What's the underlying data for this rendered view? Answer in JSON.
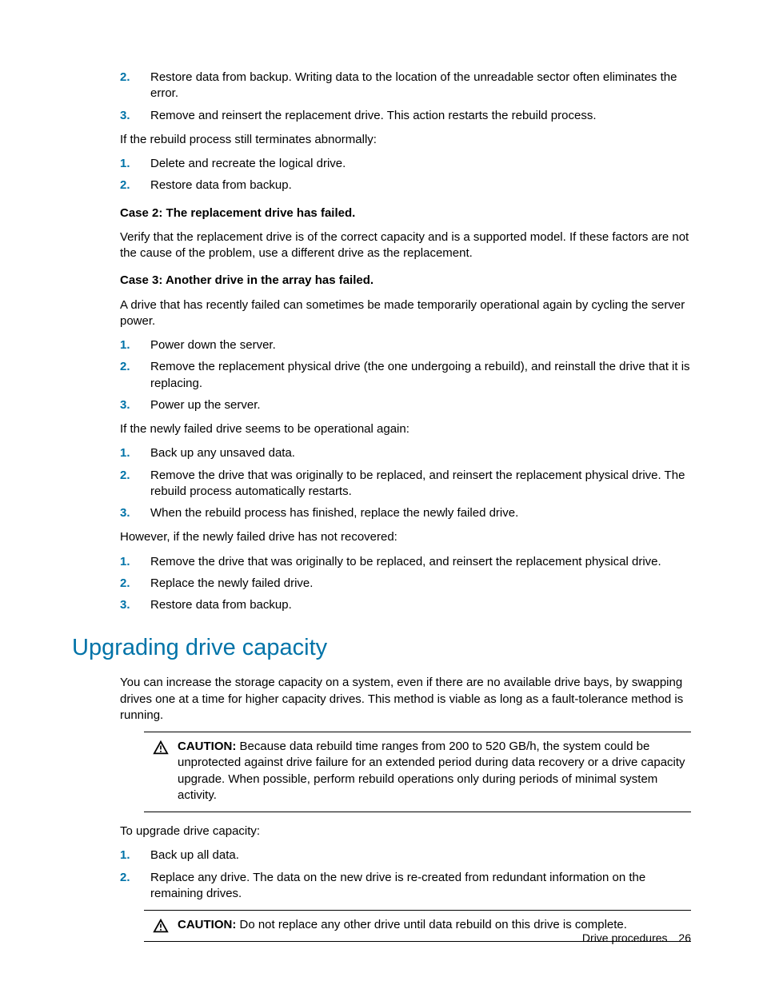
{
  "list_a": [
    {
      "n": "2.",
      "t": "Restore data from backup. Writing data to the location of the unreadable sector often eliminates the error."
    },
    {
      "n": "3.",
      "t": "Remove and reinsert the replacement drive. This action restarts the rebuild process."
    }
  ],
  "para_a": "If the rebuild process still terminates abnormally:",
  "list_b": [
    {
      "n": "1.",
      "t": "Delete and recreate the logical drive."
    },
    {
      "n": "2.",
      "t": "Restore data from backup."
    }
  ],
  "case2_title": "Case 2: The replacement drive has failed.",
  "case2_body": "Verify that the replacement drive is of the correct capacity and is a supported model. If these factors are not the cause of the problem, use a different drive as the replacement.",
  "case3_title": "Case 3: Another drive in the array has failed.",
  "case3_body": "A drive that has recently failed can sometimes be made temporarily operational again by cycling the server power.",
  "list_c": [
    {
      "n": "1.",
      "t": "Power down the server."
    },
    {
      "n": "2.",
      "t": "Remove the replacement physical drive (the one undergoing a rebuild), and reinstall the drive that it is replacing."
    },
    {
      "n": "3.",
      "t": "Power up the server."
    }
  ],
  "para_c": "If the newly failed drive seems to be operational again:",
  "list_d": [
    {
      "n": "1.",
      "t": "Back up any unsaved data."
    },
    {
      "n": "2.",
      "t": "Remove the drive that was originally to be replaced, and reinsert the replacement physical drive. The rebuild process automatically restarts."
    },
    {
      "n": "3.",
      "t": "When the rebuild process has finished, replace the newly failed drive."
    }
  ],
  "para_d": "However, if the newly failed drive has not recovered:",
  "list_e": [
    {
      "n": "1.",
      "t": "Remove the drive that was originally to be replaced, and reinsert the replacement physical drive."
    },
    {
      "n": "2.",
      "t": "Replace the newly failed drive."
    },
    {
      "n": "3.",
      "t": "Restore data from backup."
    }
  ],
  "heading": "Upgrading drive capacity",
  "upgrade_intro": "You can increase the storage capacity on a system, even if there are no available drive bays, by swapping drives one at a time for higher capacity drives. This method is viable as long as a fault-tolerance method is running.",
  "caution1_label": "CAUTION:",
  "caution1_text": "Because data rebuild time ranges from 200 to 520 GB/h, the system could be unprotected against drive failure for an extended period during data recovery or a drive capacity upgrade. When possible, perform rebuild operations only during periods of minimal system activity.",
  "upgrade_lead": "To upgrade drive capacity:",
  "list_f": [
    {
      "n": "1.",
      "t": "Back up all data."
    },
    {
      "n": "2.",
      "t": "Replace any drive. The data on the new drive is re-created from redundant information on the remaining drives."
    }
  ],
  "caution2_label": "CAUTION:",
  "caution2_text": "Do not replace any other drive until data rebuild on this drive is complete.",
  "footer_label": "Drive procedures",
  "footer_page": "26"
}
